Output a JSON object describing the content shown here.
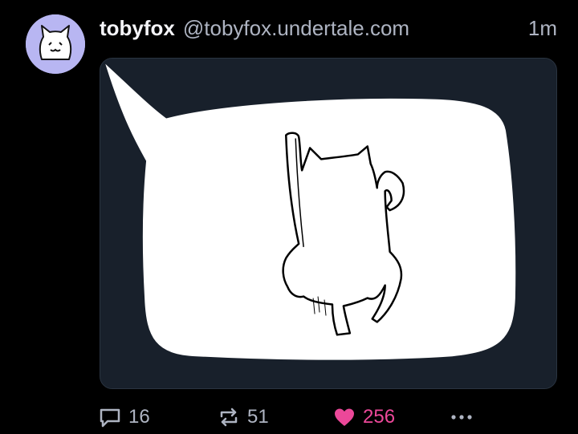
{
  "author": {
    "display_name": "tobyfox",
    "handle": "@tobyfox.undertale.com",
    "avatar_icon": "cat-face-avatar",
    "avatar_bg": "#b8b6f2"
  },
  "post": {
    "timestamp": "1m"
  },
  "actions": {
    "reply_count": "16",
    "repost_count": "51",
    "like_count": "256",
    "like_color": "#ec4899",
    "liked": true
  },
  "icons": {
    "reply": "reply-icon",
    "repost": "repost-icon",
    "like": "heart-icon",
    "more": "more-options-icon"
  }
}
